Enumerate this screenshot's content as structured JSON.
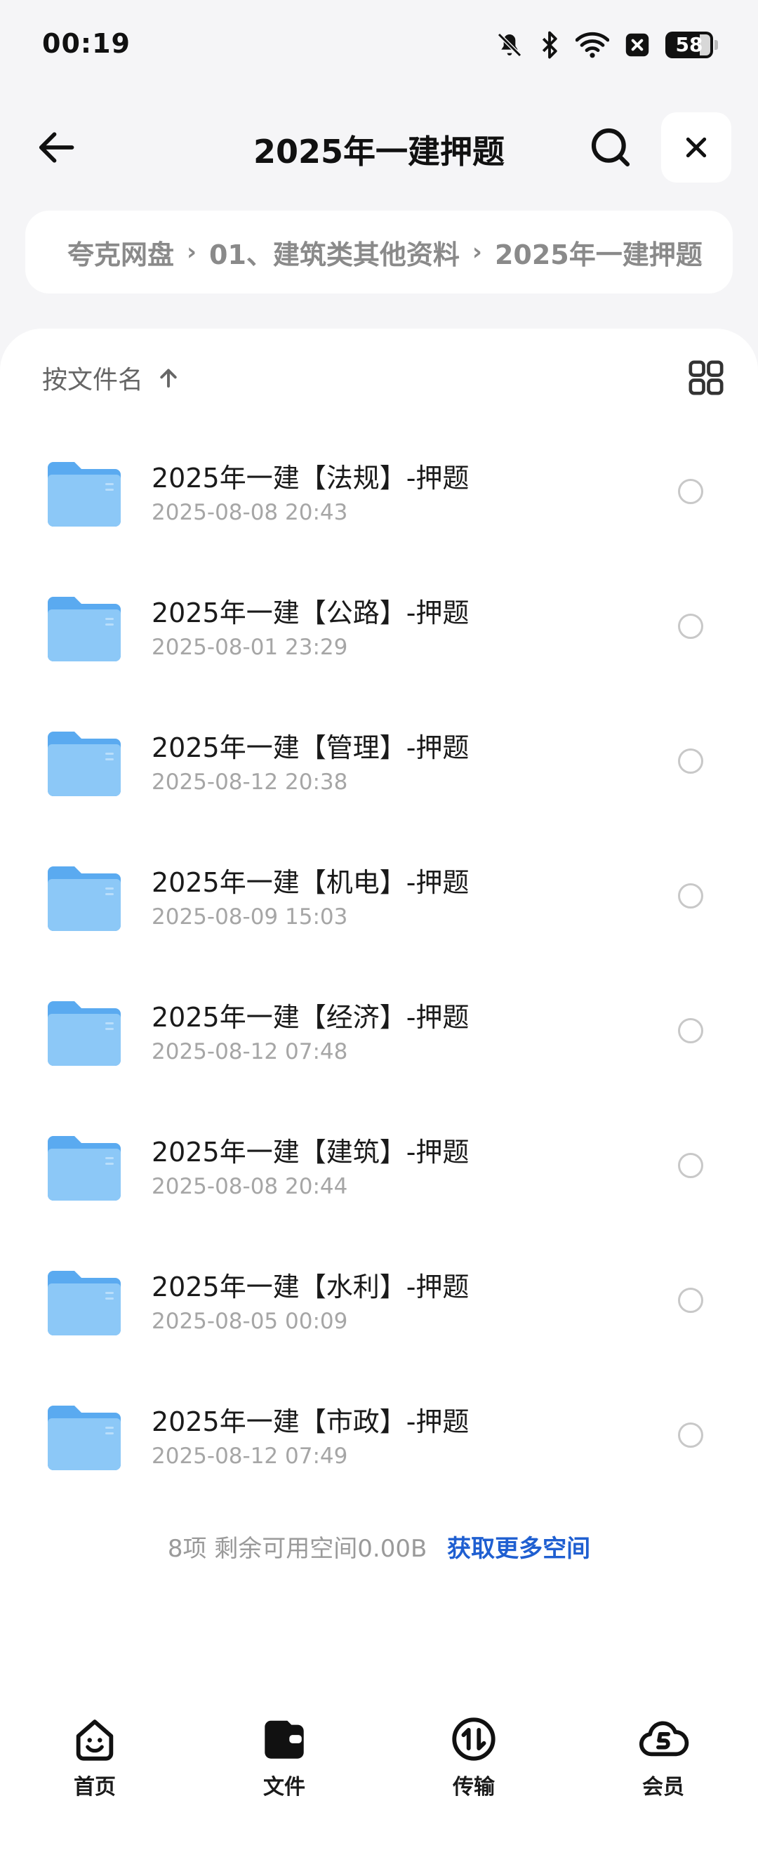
{
  "status_bar": {
    "time": "00:19",
    "battery": "58",
    "icons": [
      "bell-muted-icon",
      "bluetooth-icon",
      "wifi-icon",
      "close-box-icon",
      "battery-icon"
    ]
  },
  "header": {
    "title": "2025年一建押题",
    "back_icon": "arrow-left-icon",
    "search_icon": "search-icon",
    "close_icon": "close-icon"
  },
  "breadcrumb": {
    "items": [
      "夸克网盘",
      "01、建筑类其他资料",
      "2025年一建押题"
    ]
  },
  "sort": {
    "label": "按文件名",
    "direction_icon": "arrow-up-icon",
    "view_icon": "grid-view-icon"
  },
  "files": [
    {
      "name": "2025年一建【法规】-押题",
      "date": "2025-08-08 20:43"
    },
    {
      "name": "2025年一建【公路】-押题",
      "date": "2025-08-01 23:29"
    },
    {
      "name": "2025年一建【管理】-押题",
      "date": "2025-08-12 20:38"
    },
    {
      "name": "2025年一建【机电】-押题",
      "date": "2025-08-09 15:03"
    },
    {
      "name": "2025年一建【经济】-押题",
      "date": "2025-08-12 07:48"
    },
    {
      "name": "2025年一建【建筑】-押题",
      "date": "2025-08-08 20:44"
    },
    {
      "name": "2025年一建【水利】-押题",
      "date": "2025-08-05 00:09"
    },
    {
      "name": "2025年一建【市政】-押题",
      "date": "2025-08-12 07:49"
    }
  ],
  "footer": {
    "count_text": "8项  剩余可用空间0.00B",
    "link_text": "获取更多空间"
  },
  "nav": {
    "items": [
      {
        "label": "首页",
        "icon": "home-face-icon"
      },
      {
        "label": "文件",
        "icon": "wallet-folder-icon",
        "active": true
      },
      {
        "label": "传输",
        "icon": "transfer-icon"
      },
      {
        "label": "会员",
        "icon": "cloud-vip-icon"
      }
    ]
  },
  "colors": {
    "background": "#f5f5f7",
    "accent_link": "#1f5fd1",
    "folder": "#6eb6f2",
    "text_secondary": "#a6a6a6"
  }
}
